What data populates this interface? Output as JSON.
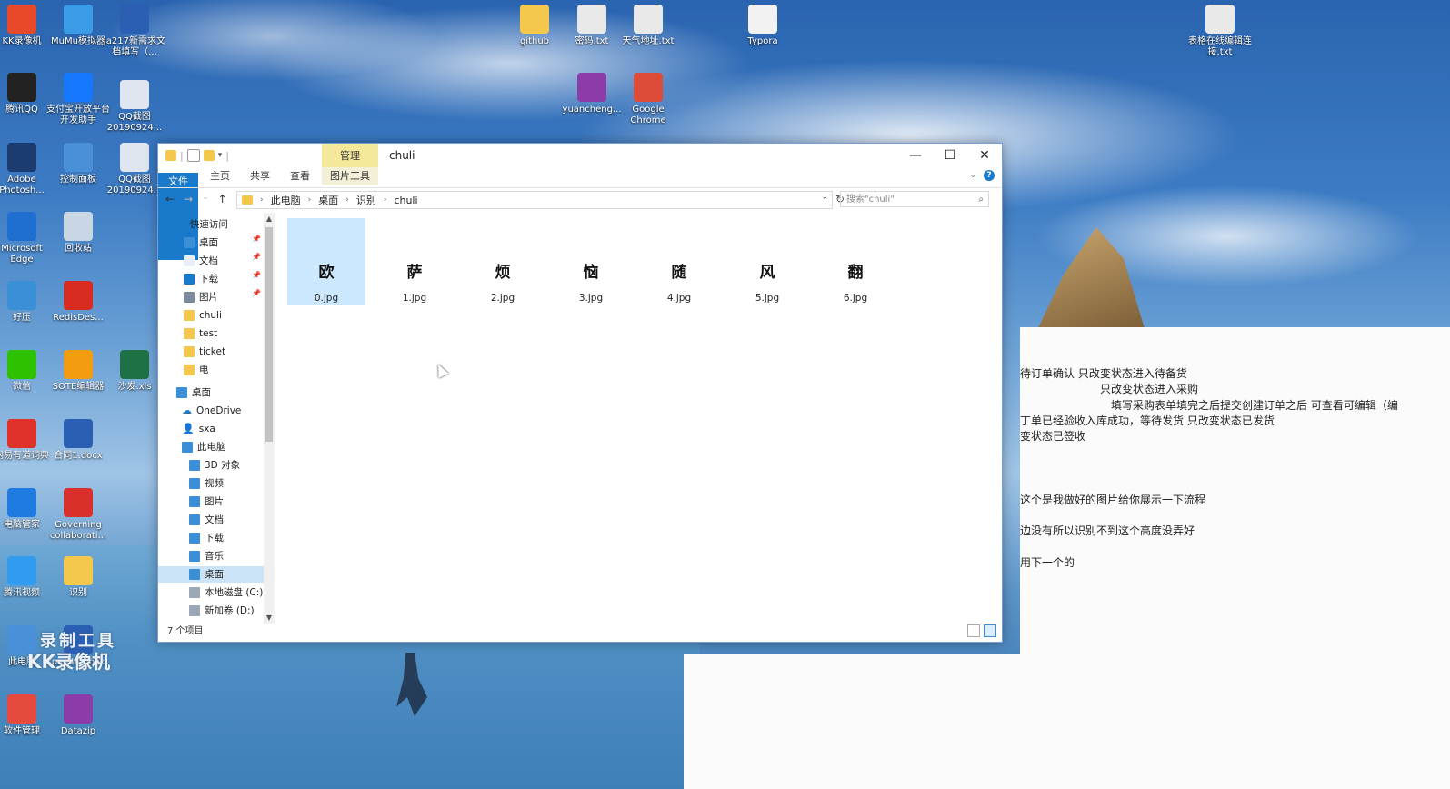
{
  "desktop": {
    "icons": [
      {
        "label": "KK录像机",
        "icon": "kk-recorder-icon",
        "color": "#e8492b"
      },
      {
        "label": "MuMu模拟器",
        "icon": "mumu-emulator-icon",
        "color": "#3b9be6"
      },
      {
        "label": "ja217新需求文档填写（...",
        "icon": "word-doc-icon",
        "color": "#2b5fb3"
      },
      {
        "label": "github",
        "icon": "folder-icon",
        "color": "#f3c84c"
      },
      {
        "label": "密码.txt",
        "icon": "text-file-icon",
        "color": "#e9e9e9"
      },
      {
        "label": "天气地址.txt",
        "icon": "text-file-icon",
        "color": "#e9e9e9"
      },
      {
        "label": "Typora",
        "icon": "typora-icon",
        "color": "#f2f2f2"
      },
      {
        "label": "表格在线编辑连接.txt",
        "icon": "text-file-icon",
        "color": "#e9e9e9"
      },
      {
        "label": "腾讯QQ",
        "icon": "qq-icon",
        "color": "#222222"
      },
      {
        "label": "支付宝开放平台开发助手",
        "icon": "alipay-icon",
        "color": "#1677ff"
      },
      {
        "label": "QQ截图20190924...",
        "icon": "screenshot-icon",
        "color": "#dfe6ef"
      },
      {
        "label": "yuancheng...",
        "icon": "winrar-icon",
        "color": "#8b3ca8"
      },
      {
        "label": "Google Chrome",
        "icon": "chrome-icon",
        "color": "#dd4b39"
      },
      {
        "label": "Adobe Photosh...",
        "icon": "photoshop-icon",
        "color": "#1c3b6e"
      },
      {
        "label": "控制面板",
        "icon": "control-panel-icon",
        "color": "#4a90d9"
      },
      {
        "label": "QQ截图20190924...",
        "icon": "screenshot-icon",
        "color": "#dfe6ef"
      },
      {
        "label": "Microsoft Edge",
        "icon": "edge-icon",
        "color": "#1f6fd1"
      },
      {
        "label": "回收站",
        "icon": "recycle-bin-icon",
        "color": "#c9d6e3"
      },
      {
        "label": "好压",
        "icon": "haozip-icon",
        "color": "#3a8fd6"
      },
      {
        "label": "RedisDes...",
        "icon": "redis-icon",
        "color": "#d82c20"
      },
      {
        "label": "微信",
        "icon": "wechat-icon",
        "color": "#2dc100"
      },
      {
        "label": "SOTE编辑器",
        "icon": "editor-icon",
        "color": "#f39c12"
      },
      {
        "label": "沙发.xls",
        "icon": "excel-icon",
        "color": "#1e7145"
      },
      {
        "label": "网易有道词典",
        "icon": "youdao-icon",
        "color": "#e0312b"
      },
      {
        "label": "合同1.docx",
        "icon": "word-doc-icon",
        "color": "#2b5fb3"
      },
      {
        "label": "电脑管家",
        "icon": "pc-manager-icon",
        "color": "#1f7be0"
      },
      {
        "label": "Governing collaborati...",
        "icon": "pdf-icon",
        "color": "#d9302b"
      },
      {
        "label": "腾讯视频",
        "icon": "tencent-video-icon",
        "color": "#2f9cf0"
      },
      {
        "label": "识别",
        "icon": "folder-icon",
        "color": "#f3c84c"
      },
      {
        "label": "此电脑",
        "icon": "this-pc-icon",
        "color": "#4a90d9"
      },
      {
        "label": "pau48.docx",
        "icon": "word-doc-icon",
        "color": "#2b5fb3"
      },
      {
        "label": "软件管理",
        "icon": "software-manager-icon",
        "color": "#e64a3c"
      },
      {
        "label": "Datazip",
        "icon": "datazip-icon",
        "color": "#8b3ca8"
      }
    ],
    "watermark": {
      "line1": "录制工具",
      "line2": "KK录像机"
    }
  },
  "document": {
    "lines": [
      "待订单确认      只改变状态进入待备货",
      "只改变状态进入采购",
      "填写采购表单填完之后提交创建订单之后 可查看可编辑（编",
      "丁单已经验收入库成功，等待发货    只改变状态已发货",
      "变状态已签收",
      "这个是我做好的图片给你展示一下流程",
      "边没有所以识别不到这个高度没弄好",
      "用下一个的"
    ]
  },
  "explorer": {
    "title": "chuli",
    "contextual_tab": "管理",
    "ribbon_tabs": [
      "文件",
      "主页",
      "共享",
      "查看",
      "图片工具"
    ],
    "window_buttons": {
      "minimize": "—",
      "maximize": "☐",
      "close": "✕"
    },
    "address": {
      "segments": [
        "此电脑",
        "桌面",
        "识别",
        "chuli"
      ]
    },
    "search_placeholder": "搜索\"chuli\"",
    "nav": {
      "quick_access": "快速访问",
      "quick_items": [
        {
          "label": "桌面",
          "pinned": true
        },
        {
          "label": "文档",
          "pinned": true
        },
        {
          "label": "下载",
          "pinned": true
        },
        {
          "label": "图片",
          "pinned": true
        },
        {
          "label": "chuli",
          "pinned": false
        },
        {
          "label": "test",
          "pinned": false
        },
        {
          "label": "ticket",
          "pinned": false
        },
        {
          "label": "电",
          "pinned": false
        }
      ],
      "desktop": "桌面",
      "onedrive": "OneDrive",
      "user": "sxa",
      "this_pc": "此电脑",
      "pc_items": [
        "3D 对象",
        "视频",
        "图片",
        "文档",
        "下载",
        "音乐",
        "桌面",
        "本地磁盘 (C:)",
        "新加卷 (D:)"
      ],
      "selected": "桌面"
    },
    "files": [
      {
        "name": "0.jpg",
        "char": "欧"
      },
      {
        "name": "1.jpg",
        "char": "萨"
      },
      {
        "name": "2.jpg",
        "char": "烦"
      },
      {
        "name": "3.jpg",
        "char": "恼"
      },
      {
        "name": "4.jpg",
        "char": "随"
      },
      {
        "name": "5.jpg",
        "char": "风"
      },
      {
        "name": "6.jpg",
        "char": "翻"
      }
    ],
    "status": "7 个项目"
  }
}
